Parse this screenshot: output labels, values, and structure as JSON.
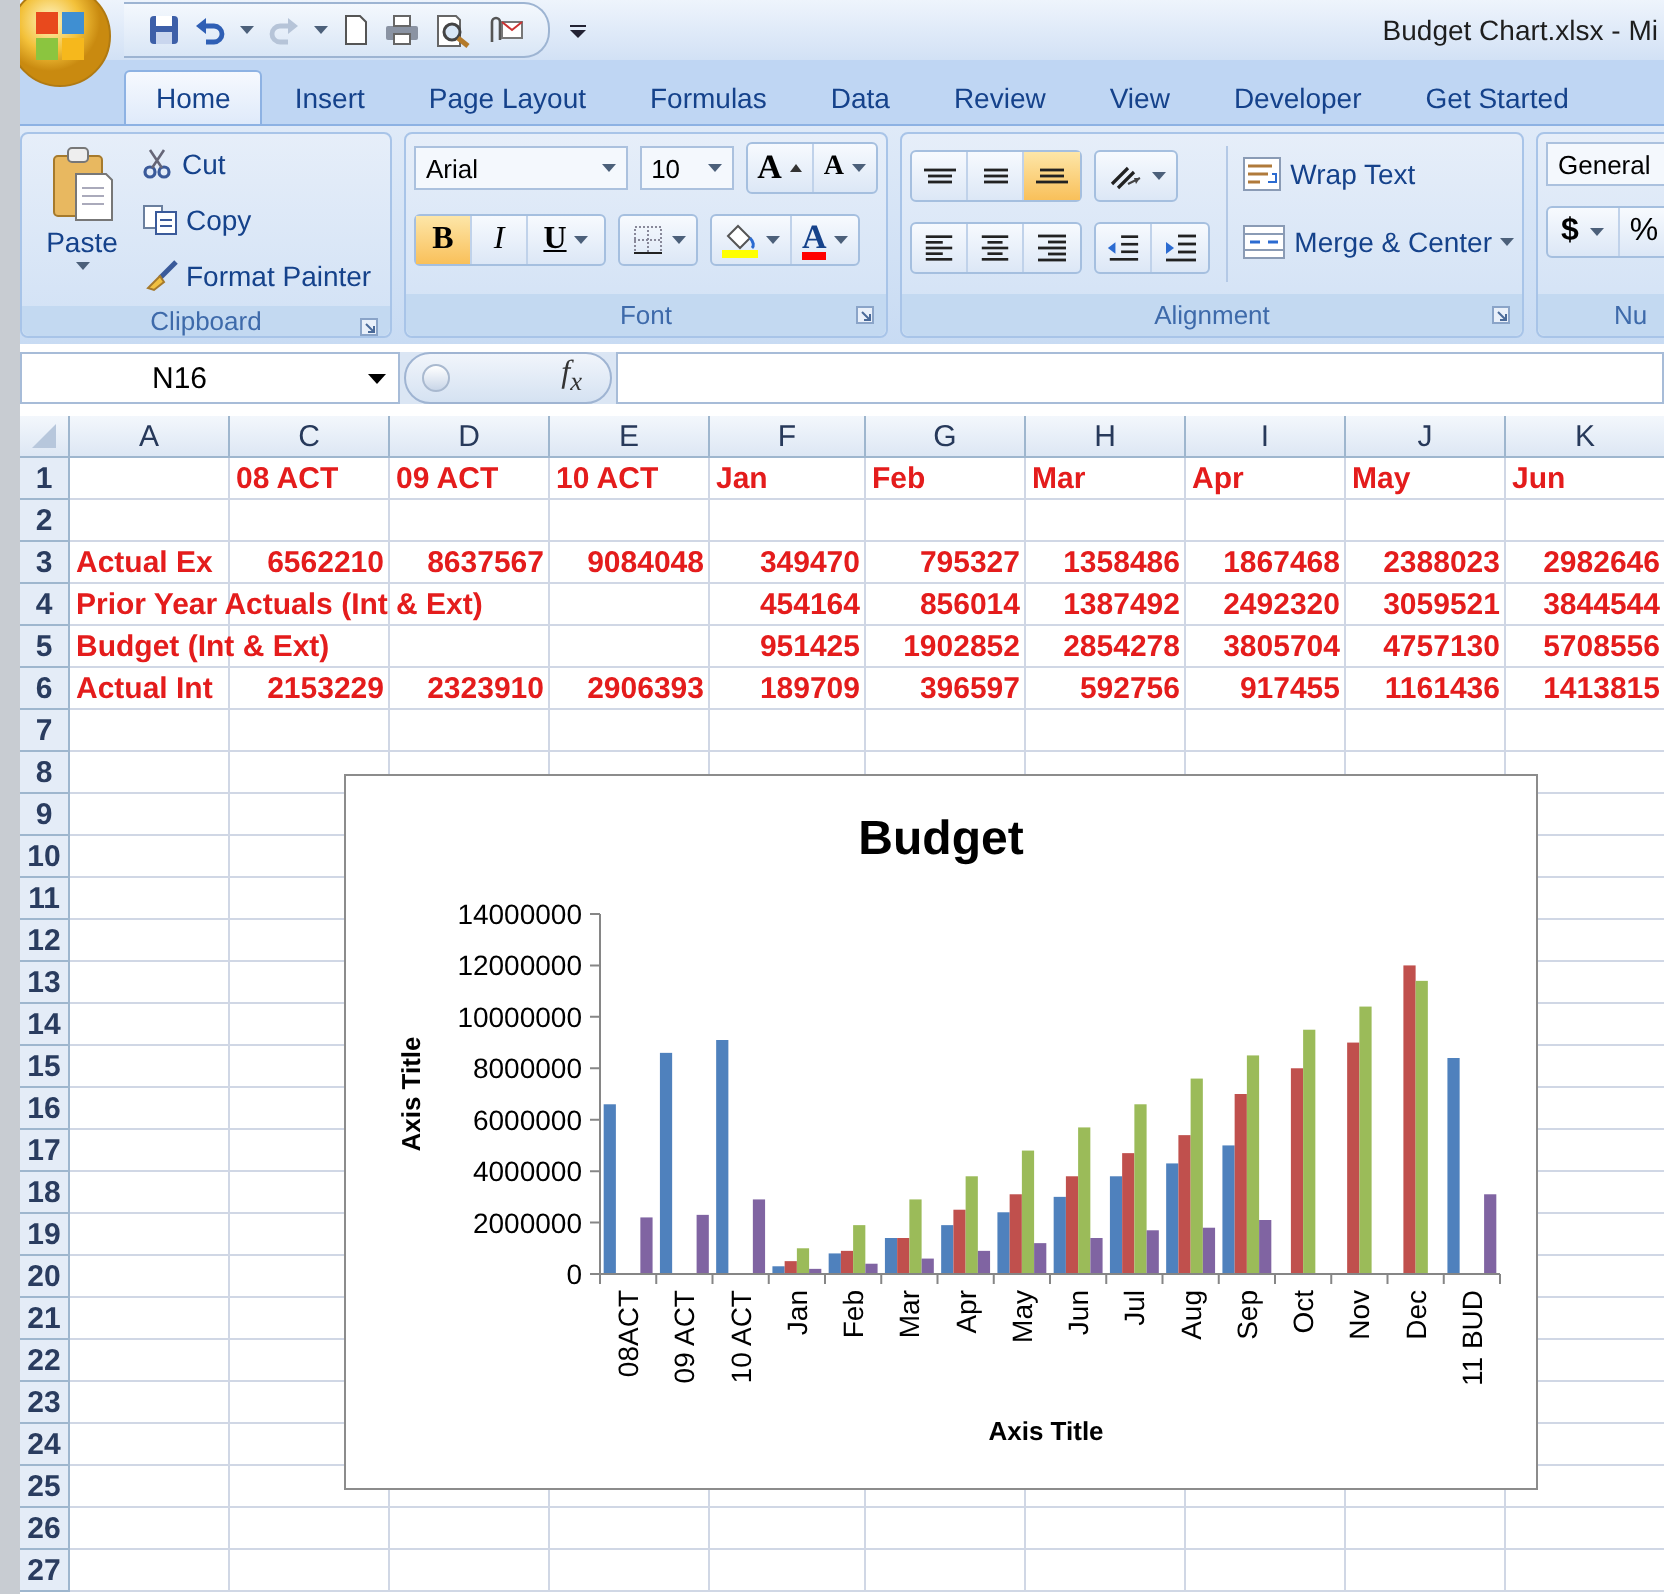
{
  "window": {
    "title": "Budget Chart.xlsx - Mi"
  },
  "ribbon": {
    "tabs": [
      {
        "label": "Home",
        "selected": true
      },
      {
        "label": "Insert",
        "selected": false
      },
      {
        "label": "Page Layout",
        "selected": false
      },
      {
        "label": "Formulas",
        "selected": false
      },
      {
        "label": "Data",
        "selected": false
      },
      {
        "label": "Review",
        "selected": false
      },
      {
        "label": "View",
        "selected": false
      },
      {
        "label": "Developer",
        "selected": false
      },
      {
        "label": "Get Started",
        "selected": false
      }
    ],
    "clipboard": {
      "label": "Clipboard",
      "paste": "Paste",
      "cut": "Cut",
      "copy": "Copy",
      "format_painter": "Format Painter"
    },
    "font": {
      "label": "Font",
      "font_name": "Arial",
      "font_size": "10",
      "grow": "A",
      "shrink": "A",
      "bold": {
        "label": "B",
        "selected": true
      },
      "italic": {
        "label": "I",
        "selected": false
      },
      "underline": {
        "label": "U",
        "selected": false
      },
      "font_color": "A"
    },
    "alignment": {
      "label": "Alignment",
      "vertical": [
        {
          "selected": false
        },
        {
          "selected": false
        },
        {
          "selected": true
        }
      ],
      "wrap_text": "Wrap Text",
      "merge_center": "Merge & Center"
    },
    "number": {
      "label": "Nu",
      "format": "General",
      "currency": "$",
      "percent": "%"
    }
  },
  "formula_bar": {
    "name_box": "N16",
    "function_label": "f$_{x}$"
  },
  "sheet": {
    "columns": [
      "A",
      "C",
      "D",
      "E",
      "F",
      "G",
      "H",
      "I",
      "J",
      "K"
    ],
    "rows": [
      {
        "number": "1",
        "kind": "header",
        "cells": [
          null,
          "08 ACT",
          "09 ACT",
          "10 ACT",
          "Jan",
          "Feb",
          "Mar",
          "Apr",
          "May",
          "Jun"
        ]
      },
      {
        "number": "2"
      },
      {
        "number": "3",
        "kind": "data",
        "cells": [
          "Actual Ex",
          "6562210",
          "8637567",
          "9084048",
          "349470",
          "795327",
          "1358486",
          "1867468",
          "2388023",
          "2982646"
        ]
      },
      {
        "number": "4",
        "kind": "data",
        "cells": [
          "Prior Year Actuals (Int & Ext)",
          null,
          null,
          null,
          "454164",
          "856014",
          "1387492",
          "2492320",
          "3059521",
          "3844544"
        ]
      },
      {
        "number": "5",
        "kind": "data",
        "cells": [
          "Budget (Int & Ext)",
          null,
          null,
          null,
          "951425",
          "1902852",
          "2854278",
          "3805704",
          "4757130",
          "5708556"
        ]
      },
      {
        "number": "6",
        "kind": "data",
        "cells": [
          "Actual Int",
          "2153229",
          "2323910",
          "2906393",
          "189709",
          "396597",
          "592756",
          "917455",
          "1161436",
          "1413815"
        ]
      },
      {
        "number": "7"
      },
      {
        "number": "8"
      },
      {
        "number": "9"
      },
      {
        "number": "10"
      },
      {
        "number": "11"
      },
      {
        "number": "12"
      },
      {
        "number": "13"
      },
      {
        "number": "14"
      },
      {
        "number": "15"
      },
      {
        "number": "16"
      },
      {
        "number": "17"
      },
      {
        "number": "18"
      },
      {
        "number": "19"
      },
      {
        "number": "20"
      },
      {
        "number": "21"
      },
      {
        "number": "22"
      },
      {
        "number": "23"
      },
      {
        "number": "24"
      },
      {
        "number": "25"
      },
      {
        "number": "26"
      },
      {
        "number": "27"
      }
    ],
    "chart": {
      "chart_data": {
        "type": "bar",
        "title": "Budget",
        "xlabel": "Axis Title",
        "ylabel": "Axis Title",
        "categories": [
          "08ACT",
          "09 ACT",
          "10 ACT",
          "Jan",
          "Feb",
          "Mar",
          "Apr",
          "May",
          "Jun",
          "Jul",
          "Aug",
          "Sep",
          "Oct",
          "Nov",
          "Dec",
          "11 BUD"
        ],
        "series": [
          {
            "color": "#4f81bd",
            "values": [
              6600000,
              8600000,
              9100000,
              300000,
              800000,
              1400000,
              1900000,
              2400000,
              3000000,
              3800000,
              4300000,
              5000000,
              null,
              null,
              null,
              8400000
            ]
          },
          {
            "color": "#c0504d",
            "values": [
              null,
              null,
              null,
              500000,
              900000,
              1400000,
              2500000,
              3100000,
              3800000,
              4700000,
              5400000,
              7000000,
              8000000,
              9000000,
              12000000,
              null
            ]
          },
          {
            "color": "#9bbb59",
            "values": [
              null,
              null,
              null,
              1000000,
              1900000,
              2900000,
              3800000,
              4800000,
              5700000,
              6600000,
              7600000,
              8500000,
              9500000,
              10400000,
              11400000,
              null
            ]
          },
          {
            "color": "#8064a2",
            "values": [
              2200000,
              2300000,
              2900000,
              200000,
              400000,
              600000,
              900000,
              1200000,
              1400000,
              1700000,
              1800000,
              2100000,
              null,
              null,
              null,
              3100000
            ]
          }
        ],
        "ylim": [
          0,
          14000000
        ],
        "yticks": [
          0,
          2000000,
          4000000,
          6000000,
          8000000,
          10000000,
          12000000,
          14000000
        ]
      }
    }
  }
}
